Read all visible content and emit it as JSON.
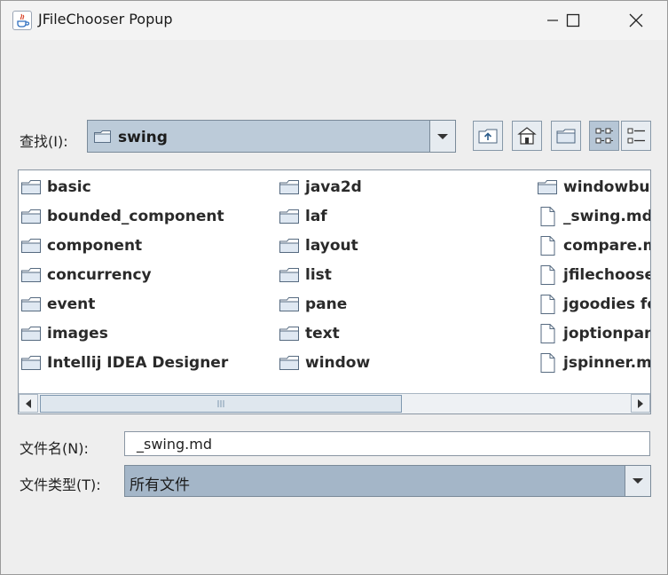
{
  "window": {
    "title": "JFileChooser Popup"
  },
  "lookin": {
    "label": "查找(I):",
    "value": "swing"
  },
  "toolbar": [
    "up-one-level",
    "home",
    "new-folder",
    "list-view",
    "details-view"
  ],
  "files": [
    {
      "name": "basic",
      "type": "folder"
    },
    {
      "name": "bounded_component",
      "type": "folder"
    },
    {
      "name": "component",
      "type": "folder"
    },
    {
      "name": "concurrency",
      "type": "folder"
    },
    {
      "name": "event",
      "type": "folder"
    },
    {
      "name": "images",
      "type": "folder"
    },
    {
      "name": "Intellij IDEA Designer",
      "type": "folder"
    },
    {
      "name": "java2d",
      "type": "folder"
    },
    {
      "name": "laf",
      "type": "folder"
    },
    {
      "name": "layout",
      "type": "folder"
    },
    {
      "name": "list",
      "type": "folder"
    },
    {
      "name": "pane",
      "type": "folder"
    },
    {
      "name": "text",
      "type": "folder"
    },
    {
      "name": "window",
      "type": "folder"
    },
    {
      "name": "windowbuil",
      "type": "folder"
    },
    {
      "name": "_swing.md",
      "type": "file"
    },
    {
      "name": "compare.m",
      "type": "file"
    },
    {
      "name": "jfilechoose",
      "type": "file"
    },
    {
      "name": "jgoodies fo",
      "type": "file"
    },
    {
      "name": "joptionpane",
      "type": "file"
    },
    {
      "name": "jspinner.mc",
      "type": "file"
    }
  ],
  "filename": {
    "label": "文件名(N):",
    "value": "_swing.md"
  },
  "filetype": {
    "label": "文件类型(T):",
    "value": "所有文件"
  }
}
